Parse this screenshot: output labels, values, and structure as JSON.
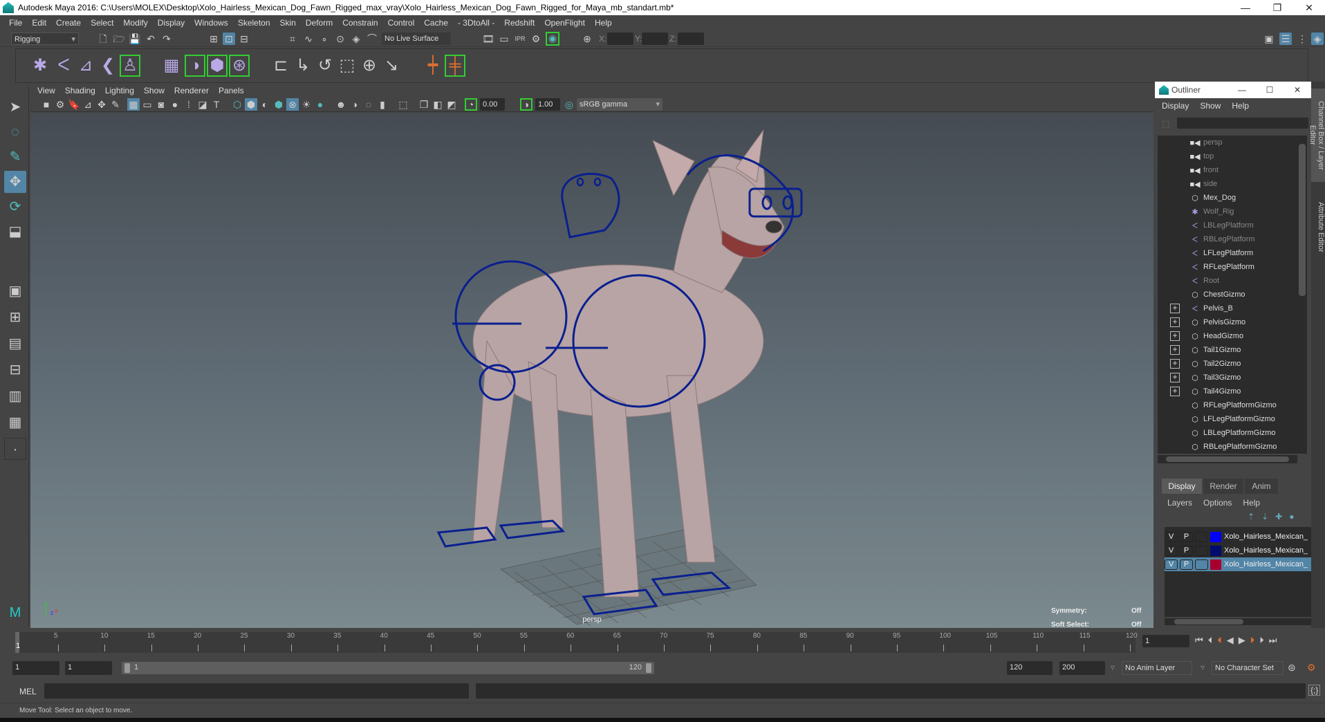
{
  "window": {
    "title": "Autodesk Maya 2016: C:\\Users\\MOLEX\\Desktop\\Xolo_Hairless_Mexican_Dog_Fawn_Rigged_max_vray\\Xolo_Hairless_Mexican_Dog_Fawn_Rigged_for_Maya_mb_standart.mb*",
    "minimize": "—",
    "maximize": "❐",
    "close": "✕"
  },
  "menubar": [
    "File",
    "Edit",
    "Create",
    "Select",
    "Modify",
    "Display",
    "Windows",
    "Skeleton",
    "Skin",
    "Deform",
    "Constrain",
    "Control",
    "Cache",
    "- 3DtoAll -",
    "Redshift",
    "OpenFlight",
    "Help"
  ],
  "statusline": {
    "menuset": "Rigging",
    "live_surface": "No Live Surface",
    "x_label": "X:",
    "y_label": "Y:",
    "z_label": "Z:",
    "x_value": "",
    "y_value": "",
    "z_value": ""
  },
  "panel": {
    "menus": [
      "View",
      "Shading",
      "Lighting",
      "Show",
      "Renderer",
      "Panels"
    ],
    "exposure": "0.00",
    "gamma": "1.00",
    "color_space": "sRGB gamma"
  },
  "viewport": {
    "camera": "persp",
    "hud": [
      {
        "label": "Symmetry:",
        "value": "Off"
      },
      {
        "label": "Soft Select:",
        "value": "Off"
      }
    ],
    "axis": {
      "y": "y",
      "z": "z",
      "x": "x"
    }
  },
  "outliner": {
    "title": "Outliner",
    "menus": [
      "Display",
      "Show",
      "Help"
    ],
    "filter_value": "",
    "items": [
      {
        "label": "persp",
        "icon": "camera-icon",
        "glyph": "■◀",
        "dim": true,
        "expandable": false
      },
      {
        "label": "top",
        "icon": "camera-icon",
        "glyph": "■◀",
        "dim": true,
        "expandable": false
      },
      {
        "label": "front",
        "icon": "camera-icon",
        "glyph": "■◀",
        "dim": true,
        "expandable": false
      },
      {
        "label": "side",
        "icon": "camera-icon",
        "glyph": "■◀",
        "dim": true,
        "expandable": false
      },
      {
        "label": "Mex_Dog",
        "icon": "mesh-icon",
        "glyph": "⬡",
        "dim": false,
        "expandable": false
      },
      {
        "label": "Wolf_Rig",
        "icon": "joint-star-icon",
        "glyph": "✱",
        "dim": true,
        "expandable": false
      },
      {
        "label": "LBLegPlatform",
        "icon": "joint-icon",
        "glyph": "ᐸ",
        "dim": true,
        "expandable": false
      },
      {
        "label": "RBLegPlatform",
        "icon": "joint-icon",
        "glyph": "ᐸ",
        "dim": true,
        "expandable": false
      },
      {
        "label": "LFLegPlatform",
        "icon": "joint-icon",
        "glyph": "ᐸ",
        "dim": false,
        "expandable": false
      },
      {
        "label": "RFLegPlatform",
        "icon": "joint-icon",
        "glyph": "ᐸ",
        "dim": false,
        "expandable": false
      },
      {
        "label": "Root",
        "icon": "joint-icon",
        "glyph": "ᐸ",
        "dim": true,
        "expandable": false
      },
      {
        "label": "ChestGizmo",
        "icon": "mesh-icon",
        "glyph": "⬡",
        "dim": false,
        "expandable": false
      },
      {
        "label": "Pelvis_B",
        "icon": "joint-icon",
        "glyph": "ᐸ",
        "dim": false,
        "expandable": true
      },
      {
        "label": "PelvisGizmo",
        "icon": "mesh-icon",
        "glyph": "⬡",
        "dim": false,
        "expandable": true
      },
      {
        "label": "HeadGizmo",
        "icon": "mesh-icon",
        "glyph": "⬡",
        "dim": false,
        "expandable": true
      },
      {
        "label": "Tail1Gizmo",
        "icon": "mesh-icon",
        "glyph": "⬡",
        "dim": false,
        "expandable": true
      },
      {
        "label": "Tail2Gizmo",
        "icon": "mesh-icon",
        "glyph": "⬡",
        "dim": false,
        "expandable": true
      },
      {
        "label": "Tail3Gizmo",
        "icon": "mesh-icon",
        "glyph": "⬡",
        "dim": false,
        "expandable": true
      },
      {
        "label": "Tail4Gizmo",
        "icon": "mesh-icon",
        "glyph": "⬡",
        "dim": false,
        "expandable": true
      },
      {
        "label": "RFLegPlatformGizmo",
        "icon": "mesh-icon",
        "glyph": "⬡",
        "dim": false,
        "expandable": false
      },
      {
        "label": "LFLegPlatformGizmo",
        "icon": "mesh-icon",
        "glyph": "⬡",
        "dim": false,
        "expandable": false
      },
      {
        "label": "LBLegPlatformGizmo",
        "icon": "mesh-icon",
        "glyph": "⬡",
        "dim": false,
        "expandable": false
      },
      {
        "label": "RBLegPlatformGizmo",
        "icon": "mesh-icon",
        "glyph": "⬡",
        "dim": false,
        "expandable": false
      }
    ]
  },
  "sidetabs": [
    "Channel Box / Layer Editor",
    "Attribute Editor"
  ],
  "layer_editor": {
    "tabs": [
      "Display",
      "Render",
      "Anim"
    ],
    "active_tab": "Display",
    "menus": [
      "Layers",
      "Options",
      "Help"
    ],
    "layers": [
      {
        "v": "V",
        "p": "P",
        "color": "#0000ff",
        "name": "Xolo_Hairless_Mexican_",
        "selected": false
      },
      {
        "v": "V",
        "p": "P",
        "color": "#000b6e",
        "name": "Xolo_Hairless_Mexican_",
        "selected": false
      },
      {
        "v": "V",
        "p": "P",
        "color": "#a8002e",
        "name": "Xolo_Hairless_Mexican_",
        "selected": true
      }
    ]
  },
  "timeline": {
    "start": 1,
    "end": 120,
    "labels": [
      "5",
      "10",
      "15",
      "20",
      "25",
      "30",
      "35",
      "40",
      "45",
      "50",
      "55",
      "60",
      "65",
      "70",
      "75",
      "80",
      "85",
      "90",
      "95",
      "100",
      "105",
      "110",
      "115",
      "120"
    ],
    "current_marker": "1",
    "current_frame": "1"
  },
  "range": {
    "anim_start": "1",
    "playback_start": "1",
    "slider_start": "1",
    "slider_end": "120",
    "playback_end": "120",
    "anim_end": "200",
    "anim_layer": "No Anim Layer",
    "character_set": "No Character Set"
  },
  "command": {
    "label": "MEL",
    "value": ""
  },
  "help_line": "Move Tool: Select an object to move.",
  "colors": {
    "accent": "#5285a6",
    "gizmo_blue": "#0a1f8f",
    "highlight_green": "#33cc33"
  }
}
